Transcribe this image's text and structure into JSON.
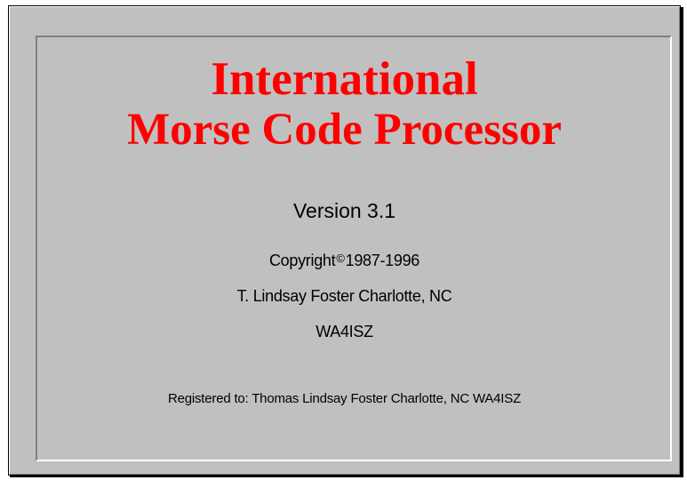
{
  "splash": {
    "title_line1": "International",
    "title_line2": "Morse Code Processor",
    "version": "Version 3.1",
    "copyright_prefix": "Copyright",
    "copyright_symbol": "©",
    "copyright_years": "1987-1996",
    "author": "T. Lindsay Foster  Charlotte, NC",
    "callsign": "WA4ISZ",
    "registered_to": "Registered to:  Thomas Lindsay Foster  Charlotte, NC  WA4ISZ"
  },
  "colors": {
    "background": "#c0c0c0",
    "title": "#ff0000",
    "text": "#000000"
  }
}
